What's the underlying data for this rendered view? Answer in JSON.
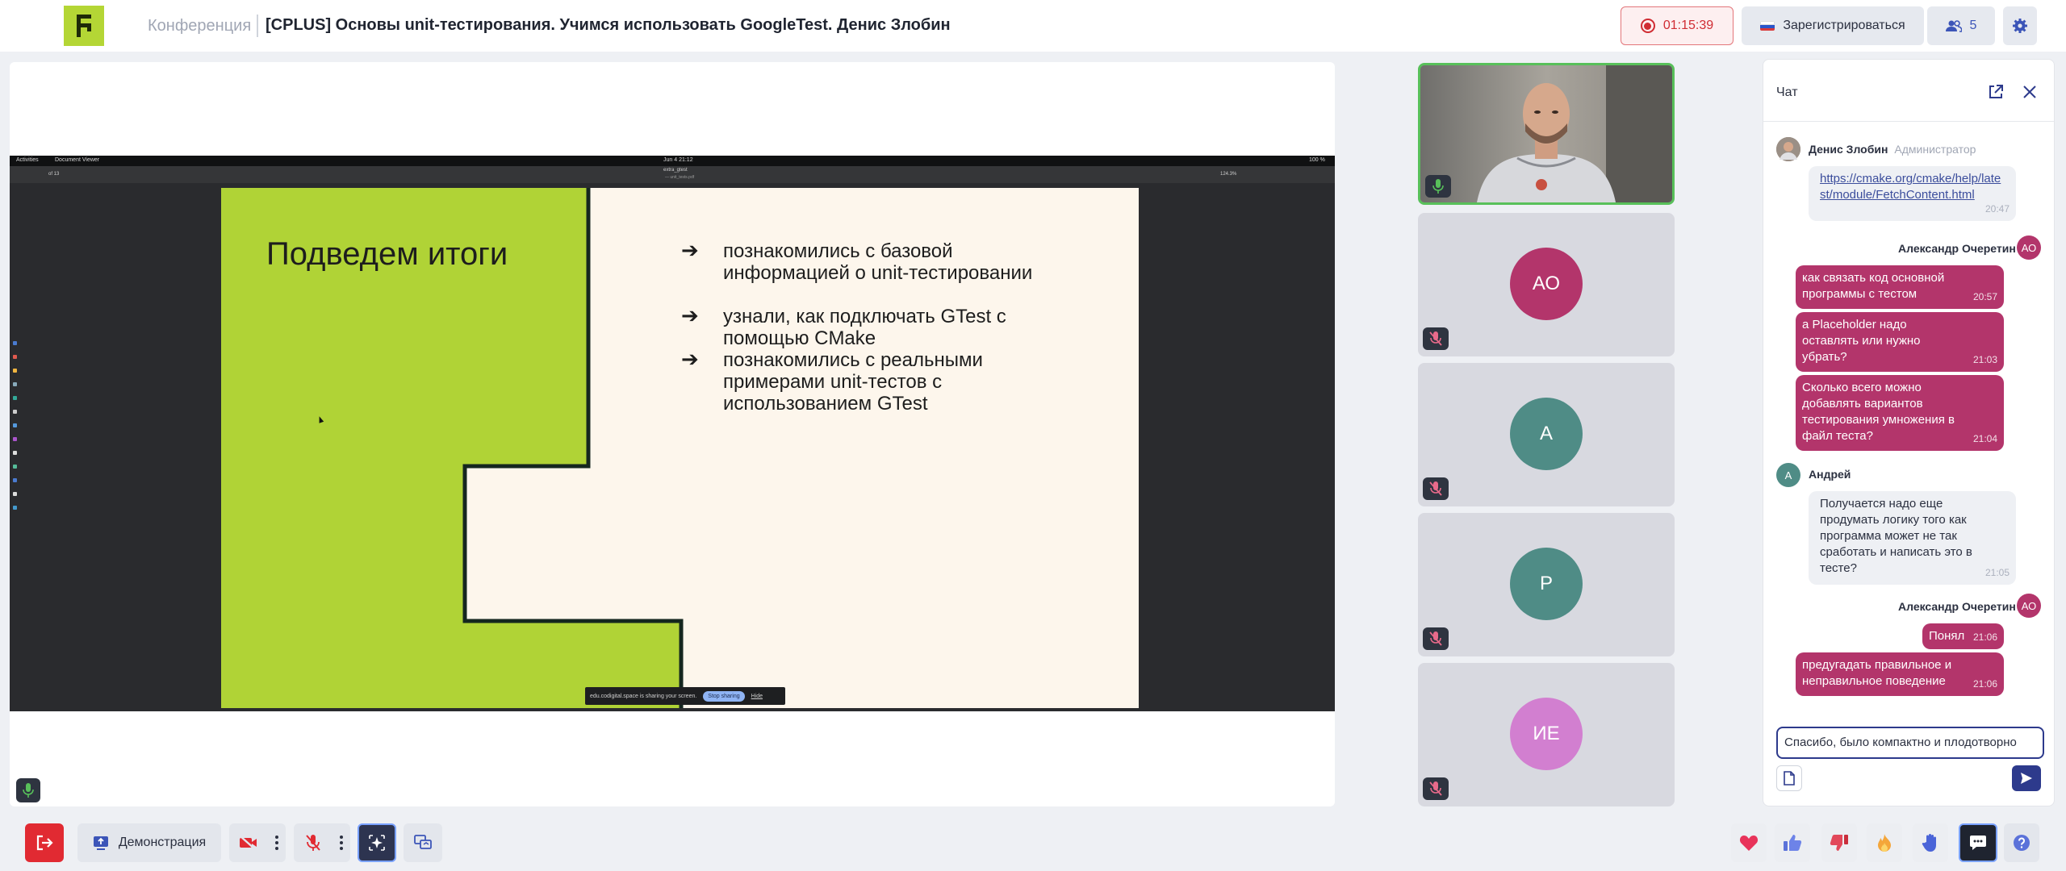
{
  "header": {
    "conference_label": "Конференция",
    "title": "[CPLUS] Основы unit-тестирования. Учимся использовать GoogleTest. Денис Злобин",
    "recording_time": "01:15:39",
    "register_label": "Зарегистрироваться",
    "participants_count": "5"
  },
  "shared_screen": {
    "topbar": {
      "activities": "Activities",
      "app": "Document Viewer",
      "clock": "Jun 4  21:12",
      "right": "100 %"
    },
    "viewer": {
      "filename": "extra_gtest",
      "subtitle": "— unit_tests.pdf",
      "page": "of 13",
      "zoom": "124.3%"
    },
    "slide": {
      "title": "Подведем итоги",
      "bullets": [
        "познакомились с базовой информацией о unit-тестировании",
        "узнали, как подключать GTest с помощью CMake",
        "познакомились с реальными примерами unit-тестов с использованием GTest"
      ],
      "bullet_glyph": "➔"
    },
    "share_notice": {
      "text": "edu.codigital.space is sharing your screen.",
      "stop": "Stop sharing",
      "hide": "Hide"
    }
  },
  "participants": [
    {
      "initials": "АО",
      "color": "#b3356b"
    },
    {
      "initials": "А",
      "color": "#4f8c86"
    },
    {
      "initials": "Р",
      "color": "#4f8c86"
    },
    {
      "initials": "ИЕ",
      "color": "#d27fd0"
    }
  ],
  "chat": {
    "title": "Чат",
    "messages": [
      {
        "author": "Денис Злобин",
        "role": "Администратор",
        "text": "https://cmake.org/cmake/help/latest/module/FetchContent.html",
        "time": "20:47"
      },
      {
        "author": "Александр Очеретин",
        "initials": "АО",
        "text": "как связать код основной программы с тестом",
        "time": "20:57"
      },
      {
        "text": "а Placeholder надо оставлять или нужно убрать?",
        "time": "21:03"
      },
      {
        "text": "Сколько всего можно добавлять вариантов тестирования умножения в файл теста?",
        "time": "21:04"
      },
      {
        "author": "Андрей",
        "initials": "А",
        "text": "Получается надо еще продумать логику того как программа может не так сработать и написать это в тесте?",
        "time": "21:05"
      },
      {
        "author": "Александр Очеретин",
        "initials": "АО",
        "text": "Понял",
        "time": "21:06"
      },
      {
        "text": "предугадать правильное и неправильное поведение",
        "time": "21:06"
      }
    ],
    "input_value": "Спасибо, было компактно и плодотворно"
  },
  "toolbar": {
    "demo_label": "Демонстрация"
  },
  "colors": {
    "accent": "#2d3a8c",
    "brand": "#b4d635",
    "outgoing_bubble": "#b3356b",
    "record": "#d02c33",
    "leave": "#e12a32"
  }
}
